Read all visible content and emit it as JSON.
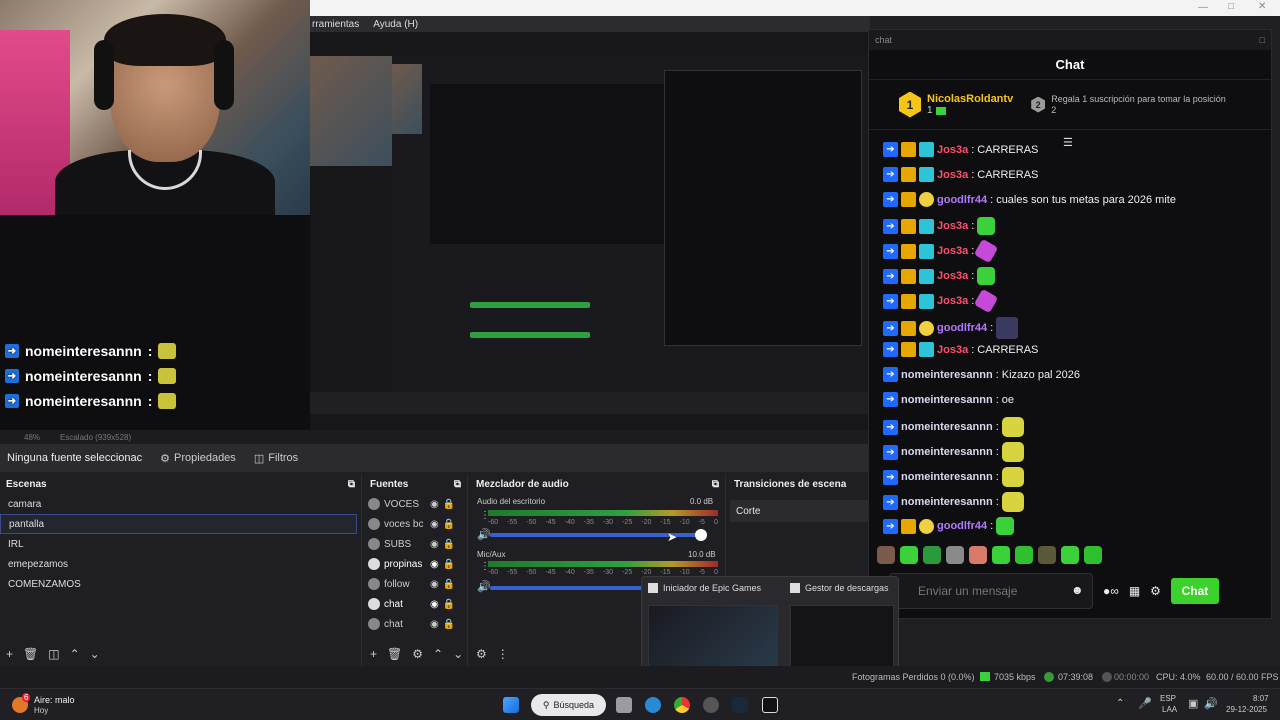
{
  "obs_menu": {
    "items": [
      "rramientas",
      "Ayuda (H)"
    ]
  },
  "overlay_chat": {
    "lines": [
      {
        "user": "nomeinteresannn",
        "sep": ":"
      },
      {
        "user": "nomeinteresannn",
        "sep": ":"
      },
      {
        "user": "nomeinteresannn",
        "sep": ":"
      }
    ]
  },
  "preview_status": {
    "zoom": "48%",
    "scale": "Escalado (939x528)"
  },
  "properties_bar": {
    "selection": "Ninguna fuente seleccionac",
    "properties": "Propiedades",
    "filters": "Filtros"
  },
  "scenes": {
    "title": "Escenas",
    "items": [
      "camara",
      "pantalla",
      "IRL",
      "emepezamos",
      "COMENZAMOS"
    ],
    "selected_index": 1
  },
  "sources": {
    "title": "Fuentes",
    "items": [
      "VOCES",
      "voces bc",
      "SUBS",
      "propinas",
      "follow",
      "chat",
      "chat"
    ]
  },
  "audio_mixer": {
    "title": "Mezclador de audio",
    "tracks": [
      {
        "name": "Audio del escritorio",
        "db": "0.0 dB",
        "volume": 0.95
      },
      {
        "name": "Mic/Aux",
        "db": "10.0 dB",
        "volume": 0.72
      }
    ],
    "scale": [
      "-60",
      "-55",
      "-50",
      "-45",
      "-40",
      "-35",
      "-30",
      "-25",
      "-20",
      "-15",
      "-10",
      "-5",
      "0"
    ]
  },
  "transitions": {
    "title": "Transiciones de escena",
    "current": "Corte"
  },
  "chat_panel": {
    "window_title": "chat",
    "title": "Chat",
    "leader": {
      "rank": "1",
      "name": "NicolasRoldantv",
      "subs": "1"
    },
    "second": {
      "rank": "2",
      "text": "Regala 1 suscripción para tomar la posición 2"
    },
    "messages": [
      {
        "user": "Jos3a",
        "text": "CARRERAS",
        "color": "#ff4f6e",
        "badges": [
          "blue",
          "crown",
          "vip"
        ]
      },
      {
        "user": "Jos3a",
        "text": "CARRERAS",
        "color": "#ff4f6e",
        "badges": [
          "blue",
          "crown",
          "vip"
        ]
      },
      {
        "user": "goodlfr44",
        "text": "cuales son tus metas para 2026 mite",
        "color": "#b479ff",
        "badges": [
          "blue",
          "crown",
          "bulb"
        ]
      },
      {
        "user": "Jos3a",
        "text": "",
        "color": "#ff4f6e",
        "badges": [
          "blue",
          "crown",
          "vip"
        ],
        "emote": "green"
      },
      {
        "user": "Jos3a",
        "text": "",
        "color": "#ff4f6e",
        "badges": [
          "blue",
          "crown",
          "vip"
        ],
        "emote": "purple"
      },
      {
        "user": "Jos3a",
        "text": "",
        "color": "#ff4f6e",
        "badges": [
          "blue",
          "crown",
          "vip"
        ],
        "emote": "green"
      },
      {
        "user": "Jos3a",
        "text": "",
        "color": "#ff4f6e",
        "badges": [
          "blue",
          "crown",
          "vip"
        ],
        "emote": "purple"
      },
      {
        "user": "goodlfr44",
        "text": "",
        "color": "#b479ff",
        "badges": [
          "blue",
          "crown",
          "bulb"
        ],
        "emote": "dark"
      },
      {
        "user": "Jos3a",
        "text": "CARRERAS",
        "color": "#ff4f6e",
        "badges": [
          "blue",
          "crown",
          "vip"
        ]
      },
      {
        "user": "nomeinteresannn",
        "text": "Kizazo pal 2026",
        "color": "#d8d8f0",
        "badges": [
          "blue"
        ]
      },
      {
        "user": "nomeinteresannn",
        "text": "oe",
        "color": "#d8d8f0",
        "badges": [
          "blue"
        ]
      },
      {
        "user": "nomeinteresannn",
        "text": "",
        "color": "#d8d8f0",
        "badges": [
          "blue"
        ],
        "emote": "yellow"
      },
      {
        "user": "nomeinteresannn",
        "text": "",
        "color": "#d8d8f0",
        "badges": [
          "blue"
        ],
        "emote": "yellow"
      },
      {
        "user": "nomeinteresannn",
        "text": "",
        "color": "#d8d8f0",
        "badges": [
          "blue"
        ],
        "emote": "yellow"
      },
      {
        "user": "nomeinteresannn",
        "text": "",
        "color": "#d8d8f0",
        "badges": [
          "blue"
        ],
        "emote": "yellow"
      },
      {
        "user": "goodlfr44",
        "text": "",
        "color": "#b479ff",
        "badges": [
          "blue",
          "crown",
          "bulb"
        ],
        "emote": "green"
      }
    ],
    "input_placeholder": "Enviar un mensaje",
    "send_label": "Chat",
    "points_label": "∞"
  },
  "taskbar_popup": {
    "item1": "Iniciador de Epic Games",
    "item2": "Gestor de descargas"
  },
  "obs_status": {
    "dropped": "Fotogramas Perdidos 0 (0.0%)",
    "bitrate": "7035 kbps",
    "stream_time": "07:39:08",
    "rec_time": "00:00:00",
    "cpu": "CPU: 4.0%",
    "fps": "60.00 / 60.00 FPS"
  },
  "taskbar": {
    "weather_title": "Aire: malo",
    "weather_sub": "Hoy",
    "weather_badge": "6",
    "search": "Búsqueda",
    "lang1": "ESP",
    "lang2": "LAA",
    "time": "8:07",
    "date": "29-12-2025"
  },
  "colors": {
    "accent": "#3cd12c",
    "twitch_blue": "#1f69ff",
    "selection": "#3a4a8a"
  }
}
